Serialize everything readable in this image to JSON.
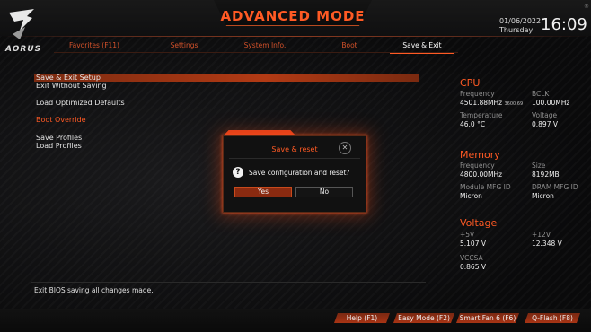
{
  "header": {
    "title": "ADVANCED MODE",
    "logo_text": "AORUS",
    "date": "01/06/2022",
    "weekday": "Thursday",
    "time": "16:09",
    "settings_glyph": "®"
  },
  "tabs": [
    {
      "label": "Favorites (F11)",
      "active": false
    },
    {
      "label": "Settings",
      "active": false
    },
    {
      "label": "System Info.",
      "active": false
    },
    {
      "label": "Boot",
      "active": false
    },
    {
      "label": "Save & Exit",
      "active": true
    }
  ],
  "menu": {
    "items": [
      {
        "label": "Save & Exit Setup",
        "selected": true
      },
      {
        "label": "Exit Without Saving"
      },
      {
        "label": "Load Optimized Defaults"
      },
      {
        "label": "Boot Override",
        "section": true
      },
      {
        "label": "Save Profiles"
      },
      {
        "label": "Load Profiles"
      }
    ]
  },
  "cpu": {
    "title": "CPU",
    "freq_label": "Frequency",
    "freq_value": "4501.88MHz",
    "freq_sub": "3600.69",
    "bclk_label": "BCLK",
    "bclk_value": "100.00MHz",
    "temp_label": "Temperature",
    "temp_value": "46.0 °C",
    "volt_label": "Voltage",
    "volt_value": "0.897 V"
  },
  "memory": {
    "title": "Memory",
    "freq_label": "Frequency",
    "freq_value": "4800.00MHz",
    "size_label": "Size",
    "size_value": "8192MB",
    "mod_mfg_label": "Module MFG ID",
    "mod_mfg_value": "Micron",
    "dram_mfg_label": "DRAM MFG ID",
    "dram_mfg_value": "Micron"
  },
  "voltage": {
    "title": "Voltage",
    "v5_label": "+5V",
    "v5_value": "5.107 V",
    "v12_label": "+12V",
    "v12_value": "12.348 V",
    "vccsa_label": "VCCSA",
    "vccsa_value": "0.865 V"
  },
  "dialog": {
    "title": "Save & reset",
    "message": "Save configuration and reset?",
    "yes_label": "Yes",
    "no_label": "No",
    "close_glyph": "✕",
    "question_glyph": "?"
  },
  "help_text": "Exit BIOS saving all changes made.",
  "footer": {
    "help": "Help (F1)",
    "easy_mode": "Easy Mode (F2)",
    "smart_fan": "Smart Fan 6 (F6)",
    "qflash": "Q-Flash (F8)"
  },
  "colors": {
    "accent": "#ff5a24",
    "selection": "#b23a14",
    "background": "#0b0b0c"
  }
}
